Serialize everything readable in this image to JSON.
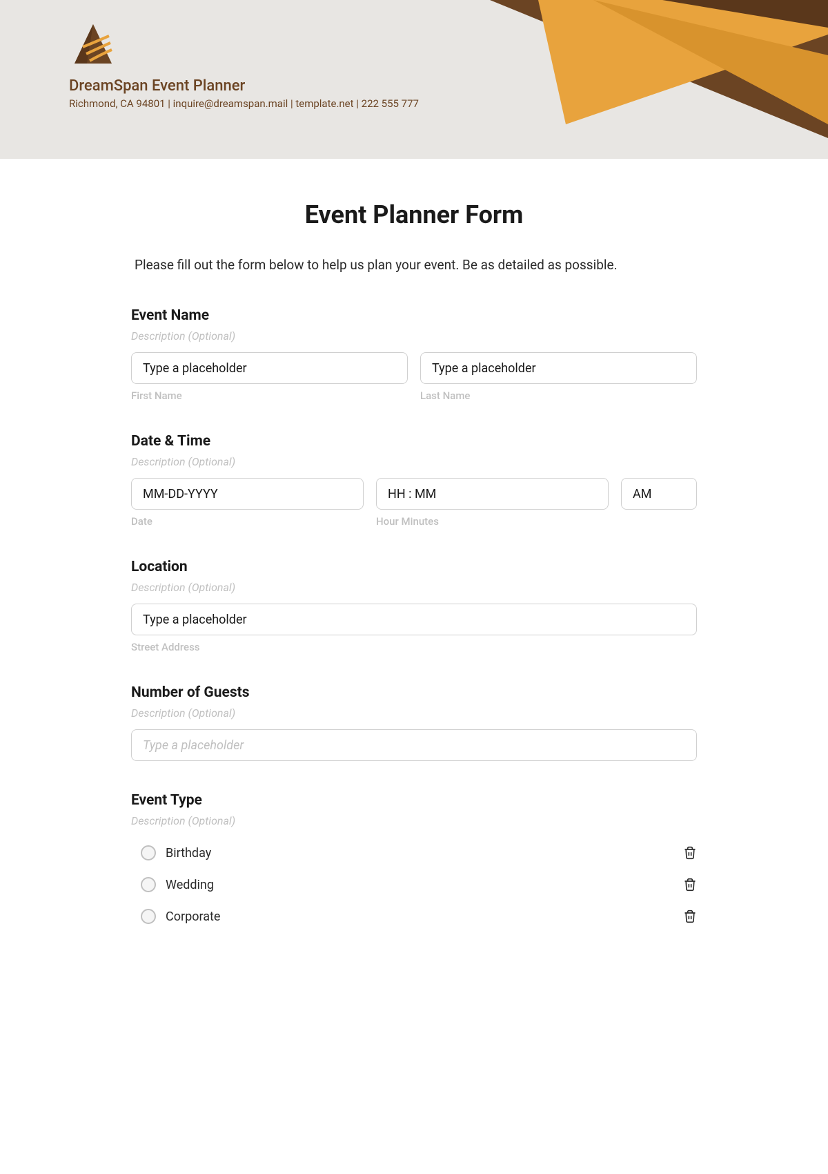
{
  "header": {
    "company_name": "DreamSpan Event Planner",
    "contact_line": "Richmond, CA 94801 | inquire@dreamspan.mail | template.net | 222 555 777"
  },
  "form": {
    "title": "Event Planner Form",
    "intro": "Please fill out the form below to help us plan your event. Be as detailed as possible."
  },
  "sections": {
    "event_name": {
      "label": "Event Name",
      "desc": "Description (Optional)",
      "first_placeholder": "Type a placeholder",
      "last_placeholder": "Type a placeholder",
      "first_sub": "First Name",
      "last_sub": "Last Name"
    },
    "date_time": {
      "label": "Date & Time",
      "desc": "Description (Optional)",
      "date_placeholder": "MM-DD-YYYY",
      "time_placeholder": "HH : MM",
      "ampm": "AM",
      "date_sub": "Date",
      "time_sub": "Hour Minutes"
    },
    "location": {
      "label": "Location",
      "desc": "Description (Optional)",
      "placeholder": "Type a placeholder",
      "sub": "Street Address"
    },
    "guests": {
      "label": "Number of Guests",
      "desc": "Description (Optional)",
      "placeholder": "Type a placeholder"
    },
    "event_type": {
      "label": "Event Type",
      "desc": "Description (Optional)",
      "options": [
        "Birthday",
        "Wedding",
        "Corporate"
      ]
    }
  }
}
